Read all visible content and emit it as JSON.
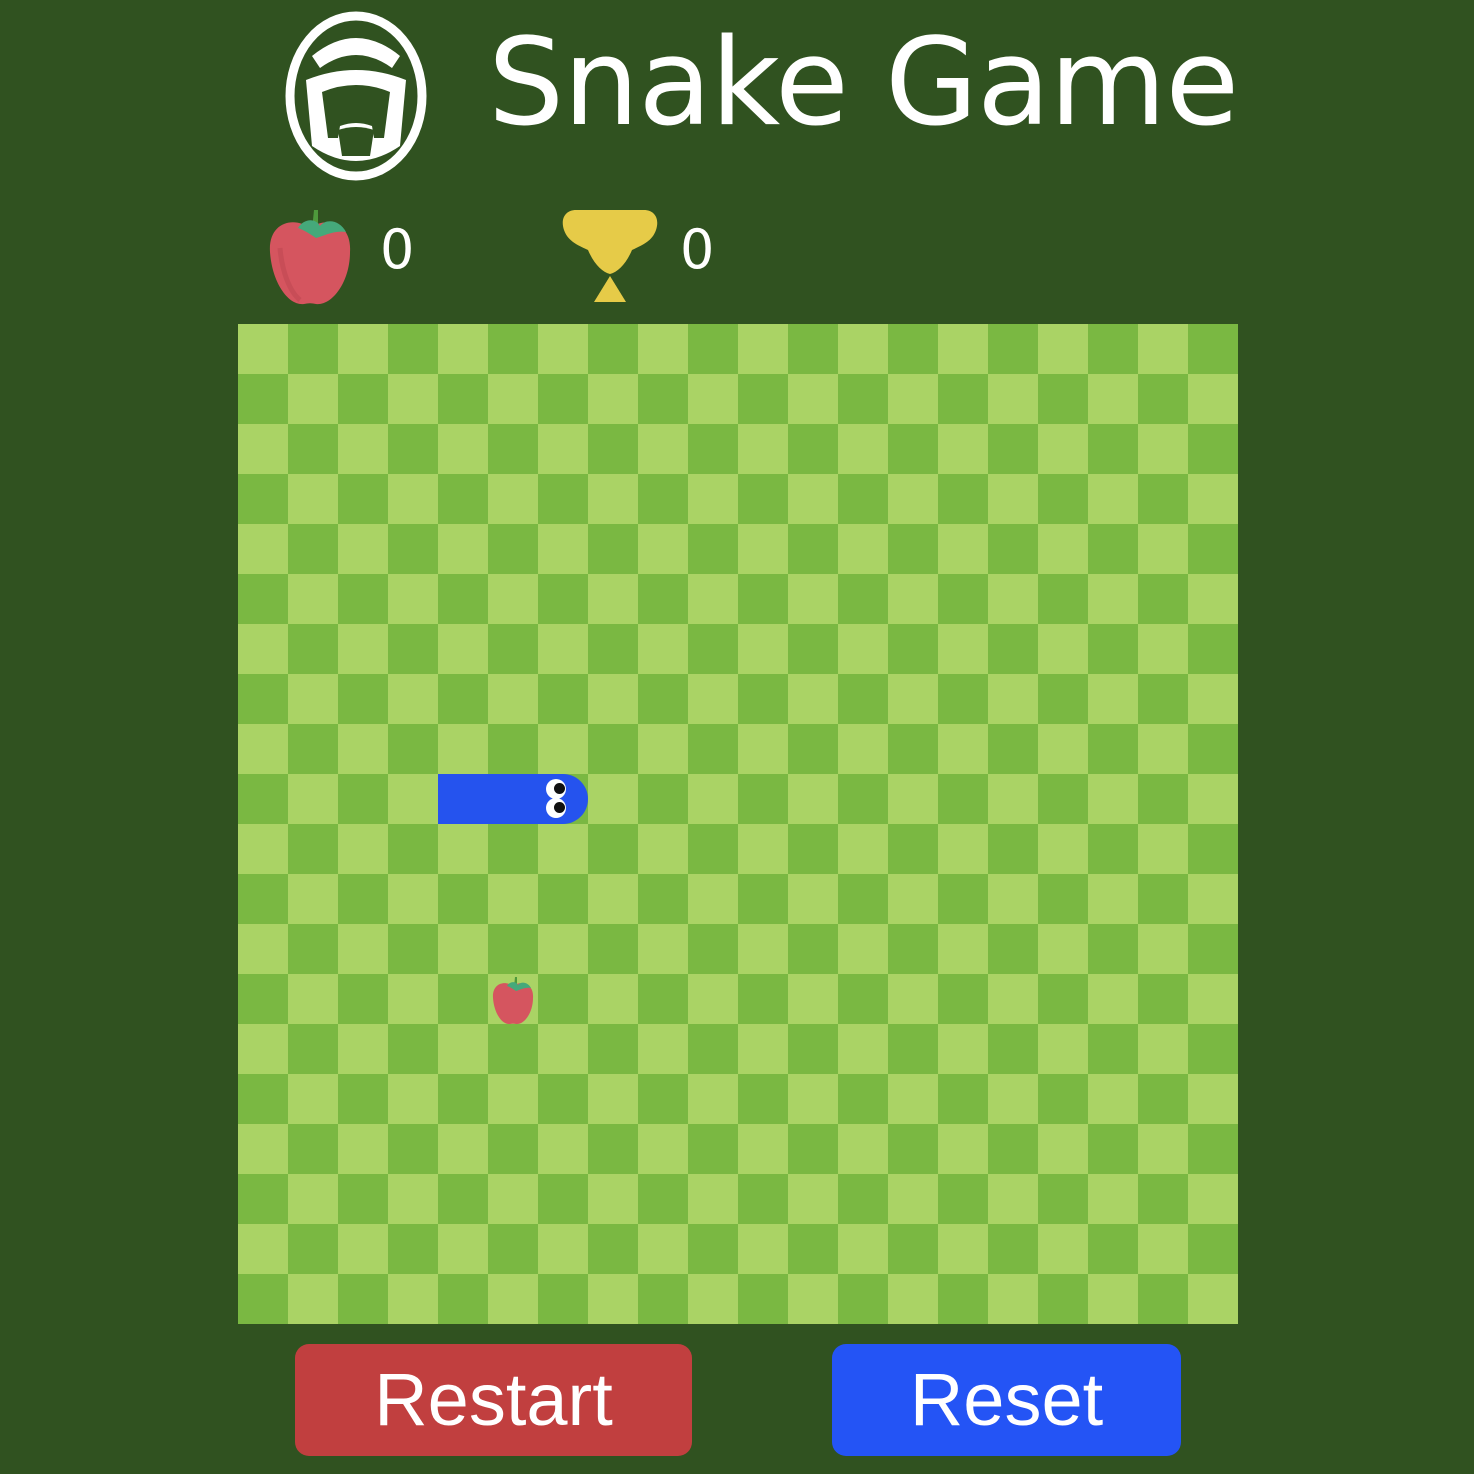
{
  "header": {
    "title": "Snake Game",
    "logo_icon": "snake-head-logo-icon"
  },
  "scores": {
    "current_icon": "apple-icon",
    "current": "0",
    "best_icon": "trophy-icon",
    "best": "0"
  },
  "board": {
    "columns": 20,
    "rows": 20,
    "colors": {
      "light": "#aad365",
      "dark": "#7ab842",
      "background": "#305220"
    },
    "snake": {
      "color": "#2553ee",
      "direction": "right",
      "segments": [
        [
          4,
          9
        ],
        [
          5,
          9
        ],
        [
          6,
          9
        ]
      ]
    },
    "apple": {
      "cell": [
        5,
        13
      ],
      "icon": "apple-icon"
    }
  },
  "buttons": {
    "restart": {
      "label": "Restart",
      "color": "#c13f3f"
    },
    "reset": {
      "label": "Reset",
      "color": "#2454f5"
    }
  }
}
